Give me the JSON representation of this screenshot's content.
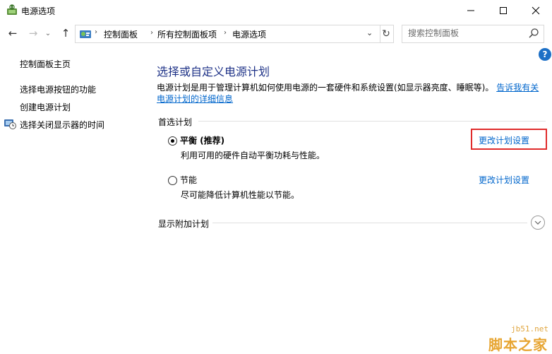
{
  "window": {
    "title": "电源选项",
    "app_icon": "power-options-icon",
    "controls": {
      "minimize": "minimize-icon",
      "maximize": "maximize-icon",
      "close": "close-icon"
    }
  },
  "address": {
    "icon": "control-panel-icon",
    "breadcrumbs": [
      "控制面板",
      "所有控制面板项",
      "电源选项"
    ],
    "separator": "›"
  },
  "search": {
    "placeholder": "搜索控制面板",
    "value": ""
  },
  "sidebar": {
    "items": [
      {
        "label": "控制面板主页"
      },
      {
        "label": "选择电源按钮的功能"
      },
      {
        "label": "创建电源计划"
      },
      {
        "label": "选择关闭显示器的时间",
        "icon": "display-clock-icon"
      }
    ]
  },
  "main": {
    "title": "选择或自定义电源计划",
    "description": "电源计划是用于管理计算机如何使用电源的一套硬件和系统设置(如显示器亮度、睡眠等)。",
    "description_link": "告诉我有关电源计划的详细信息",
    "preferred_section": "首选计划",
    "plans": [
      {
        "name": "平衡 (推荐)",
        "desc": "利用可用的硬件自动平衡功耗与性能。",
        "selected": true,
        "action": "更改计划设置"
      },
      {
        "name": "节能",
        "desc": "尽可能降低计算机性能以节能。",
        "selected": false,
        "action": "更改计划设置"
      }
    ],
    "additional_section": "显示附加计划"
  },
  "accent_colors": {
    "title_blue": "#1e3287",
    "link_blue": "#0066cc",
    "highlight_red": "#e02b2b"
  },
  "watermark": {
    "url": "jb51.net",
    "brand": "脚本之家"
  }
}
